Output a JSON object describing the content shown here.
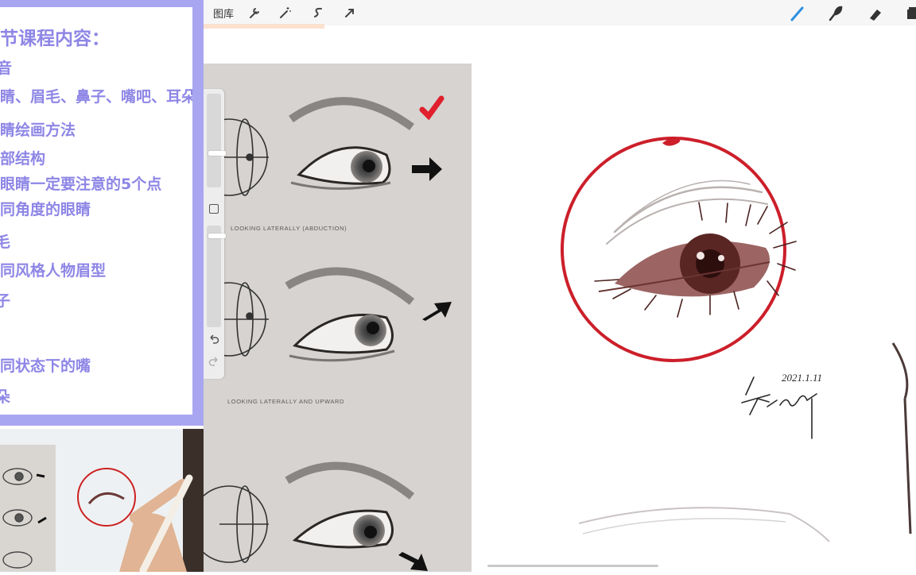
{
  "outline": {
    "title": "节课程内容：",
    "lines": [
      "音",
      "睛、眉毛、鼻子、嘴吧、耳朵",
      "睛绘画方法",
      "部结构",
      "眼睛一定要注意的5个点",
      "同角度的眼睛",
      "毛",
      "同风格人物眉型",
      "子",
      "同状态下的嘴",
      "朵"
    ],
    "text_color": "#8e86e6",
    "border_color": "#a9a6f1"
  },
  "toolbar": {
    "gallery_label": "图库",
    "left_icons": [
      "wrench-icon",
      "magic-wand-icon",
      "selection-s-icon",
      "transform-arrow-icon"
    ],
    "right_icons": [
      "brush-icon",
      "smudge-icon",
      "eraser-icon",
      "layers-icon"
    ],
    "brush_color": "#2c8fe0"
  },
  "reference": {
    "captions": [
      "LOOKING LATERALLY (ABDUCTION)",
      "LOOKING LATERALLY AND UPWARD"
    ],
    "check_color": "#e0202c"
  },
  "canvas": {
    "circle_color": "#cc1f2a",
    "signature": "2021.1.11"
  }
}
